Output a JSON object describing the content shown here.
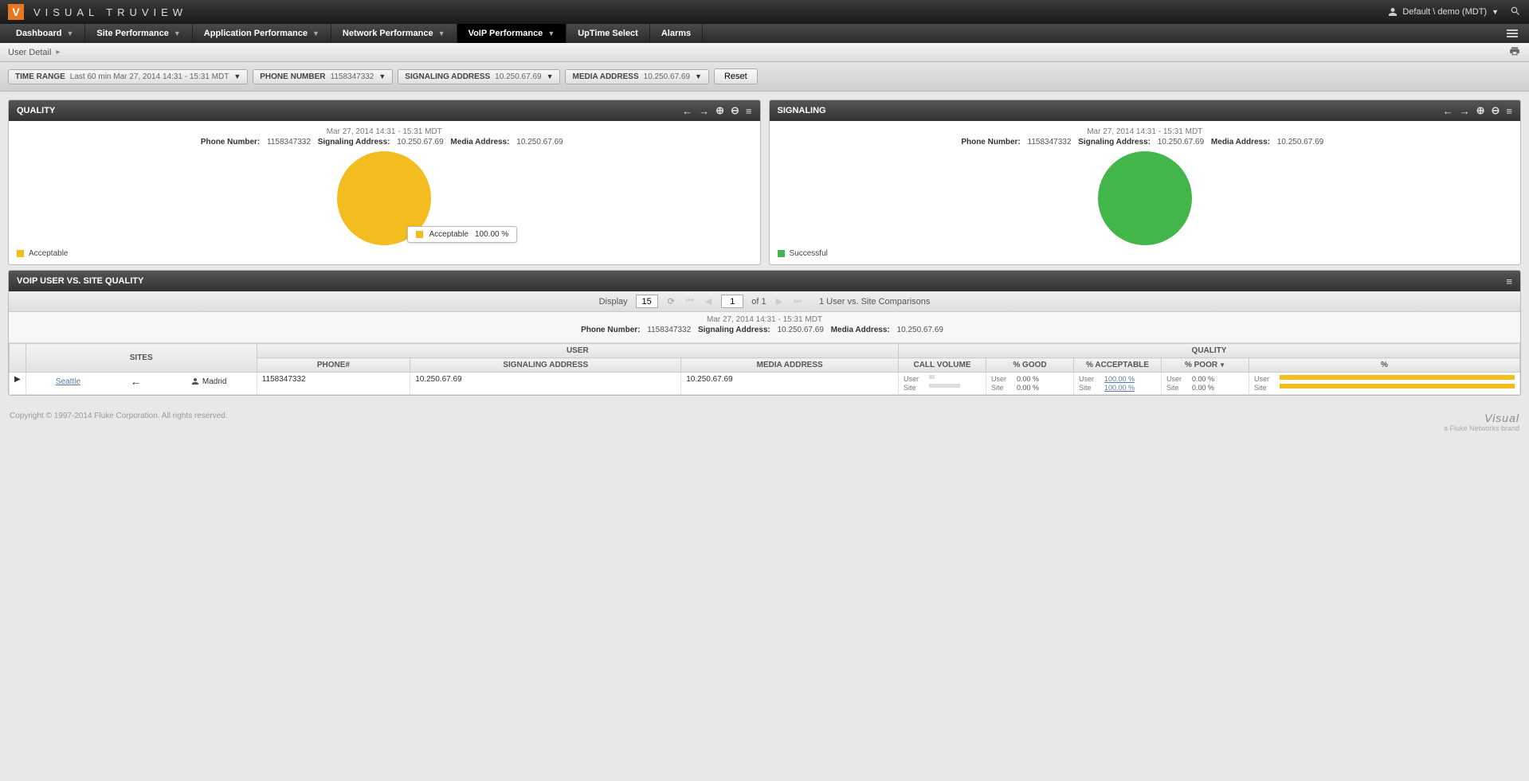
{
  "brand": "VISUAL TRUVIEW",
  "user": {
    "label": "Default \\ demo (MDT)"
  },
  "nav": {
    "items": [
      {
        "label": "Dashboard",
        "dd": true
      },
      {
        "label": "Site Performance",
        "dd": true
      },
      {
        "label": "Application Performance",
        "dd": true
      },
      {
        "label": "Network Performance",
        "dd": true
      },
      {
        "label": "VoIP Performance",
        "dd": true,
        "active": true
      },
      {
        "label": "UpTime Select"
      },
      {
        "label": "Alarms"
      }
    ]
  },
  "breadcrumb": {
    "label": "User Detail"
  },
  "filters": {
    "time": {
      "label": "TIME RANGE",
      "value": "Last 60 min Mar 27, 2014 14:31 - 15:31 MDT"
    },
    "phone": {
      "label": "PHONE NUMBER",
      "value": "1158347332"
    },
    "sig": {
      "label": "SIGNALING ADDRESS",
      "value": "10.250.67.69"
    },
    "media": {
      "label": "MEDIA ADDRESS",
      "value": "10.250.67.69"
    },
    "reset": "Reset"
  },
  "chart_data": [
    {
      "type": "pie",
      "title": "QUALITY",
      "categories": [
        "Acceptable"
      ],
      "values": [
        100.0
      ],
      "colors": [
        "#f3bd1f"
      ]
    },
    {
      "type": "pie",
      "title": "SIGNALING",
      "categories": [
        "Successful"
      ],
      "values": [
        100.0
      ],
      "colors": [
        "#43b649"
      ]
    }
  ],
  "panelQuality": {
    "title": "QUALITY",
    "date": "Mar 27, 2014 14:31 - 15:31 MDT",
    "phone_l": "Phone Number:",
    "phone_v": "1158347332",
    "sig_l": "Signaling Address:",
    "sig_v": "10.250.67.69",
    "media_l": "Media Address:",
    "media_v": "10.250.67.69",
    "legend": "Acceptable",
    "tooltip_label": "Acceptable",
    "tooltip_val": "100.00 %"
  },
  "panelSignaling": {
    "title": "SIGNALING",
    "date": "Mar 27, 2014 14:31 - 15:31 MDT",
    "phone_l": "Phone Number:",
    "phone_v": "1158347332",
    "sig_l": "Signaling Address:",
    "sig_v": "10.250.67.69",
    "media_l": "Media Address:",
    "media_v": "10.250.67.69",
    "legend": "Successful"
  },
  "table": {
    "title": "VOIP USER VS. SITE QUALITY",
    "pager": {
      "display": "Display",
      "per": "15",
      "page": "1",
      "of": "of 1",
      "summary": "1 User vs. Site Comparisons"
    },
    "meta": {
      "date": "Mar 27, 2014 14:31 - 15:31 MDT",
      "phone_l": "Phone Number:",
      "phone_v": "1158347332",
      "sig_l": "Signaling Address:",
      "sig_v": "10.250.67.69",
      "media_l": "Media Address:",
      "media_v": "10.250.67.69"
    },
    "heads": {
      "sites": "SITES",
      "user": "USER",
      "quality": "QUALITY",
      "phone": "PHONE#",
      "sigaddr": "SIGNALING ADDRESS",
      "mediaaddr": "MEDIA ADDRESS",
      "vol": "CALL VOLUME",
      "good": "% GOOD",
      "acc": "% ACCEPTABLE",
      "poor": "% POOR",
      "pct": "%"
    },
    "row": {
      "site": "Seattle",
      "dest": "Madrid",
      "phone": "1158347332",
      "sig": "10.250.67.69",
      "media": "10.250.67.69",
      "user_l": "User",
      "site_l": "Site",
      "good_user": "0.00 %",
      "good_site": "0.00 %",
      "acc_user": "100.00 %",
      "acc_site": "100.00 %",
      "poor_user": "0.00 %",
      "poor_site": "0.00 %"
    }
  },
  "footer": {
    "copy": "Copyright © 1997-2014 Fluke Corporation. All rights reserved.",
    "brand": "Visual",
    "sub": "a Fluke Networks brand"
  }
}
